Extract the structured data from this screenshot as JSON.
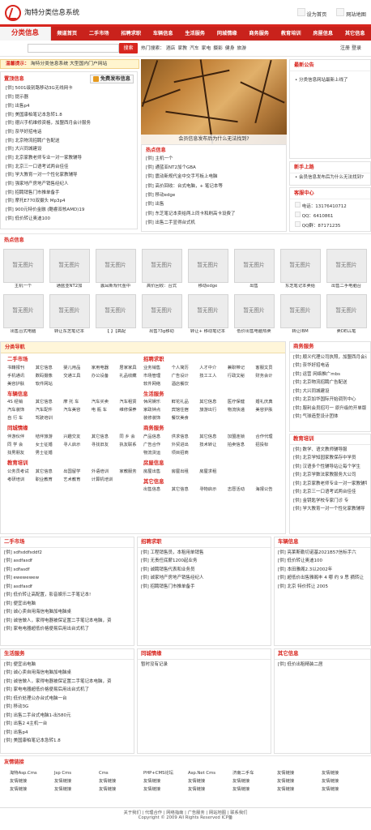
{
  "header": {
    "site_name": "淘特分类信息系统",
    "set_home": "设为首页",
    "site_map": "网站地图"
  },
  "nav": {
    "brand": "分类信息",
    "items": [
      "频道首页",
      "二手市场",
      "招聘求职",
      "车辆信息",
      "生活服务",
      "同城情缘",
      "商务服务",
      "教育培训",
      "房屋信息",
      "其它信息"
    ]
  },
  "search": {
    "button": "搜索",
    "hot_label": "热门搜索：",
    "hot_items": [
      "酒店",
      "家教",
      "汽车",
      "家电",
      "摄影",
      "健身",
      "旅游"
    ],
    "login": "注册",
    "register": "登录"
  },
  "hint": {
    "label": "温馨提示：",
    "text": "淘特分类信息系统 大型国内门户网站"
  },
  "latest": {
    "title": "置顶信息",
    "publish_btn": "免费发布信息",
    "items": [
      "[供] 5001级别路移动3G无线网卡",
      "[供] 提示器",
      "[供] 出售p4",
      "[供] 美国康柏笔记本急转1.8",
      "[供] 德兴手机维修资格，加盟西月会计服务",
      "[供] 奈华好招电话",
      "[供] 北京物流招聘广告配送",
      "[供] 大兴同城建设",
      "[供] 北京家教老师专业一对一家教辅导",
      "[供] 北京三一口语考试两台佳佳",
      "[供] 学大教育一对一个性化家教辅导",
      "[供] 强家地产房地产销售经纪人",
      "[供] 招聘销售门市推单备手",
      "[供] 摩托E770双摄头 Mp3p4",
      "[供] 900元特价金融 (酷睿双核AMD)19",
      "[供] 低价转让奥迪100"
    ]
  },
  "photo": {
    "caption": "会员信息发布后为什么无法找到?"
  },
  "hot_info": {
    "title": "热点信息",
    "items": [
      "[供] 主机一个",
      "[供] 通蓝亚NT2加个GBA",
      "[供] 震动新规代金中交手写板上电脑",
      "[供] 高价回收：台式电脑，+ 笔记本等",
      "[供] 移动edge",
      "[供] 出售",
      "[供] 东芝笔记本卖给两上同卡和刷高卡设费了",
      "[供] 出售二手显得台式机"
    ]
  },
  "notice": {
    "title": "最新公告",
    "items": [
      "分类信息网站最新上线了"
    ]
  },
  "new_users": {
    "title": "新手上路",
    "items": [
      "会员信息发布后为什么无法找到?"
    ]
  },
  "service": {
    "title": "客服中心",
    "phone_label": "电话：",
    "phone": "13176410712",
    "qq_label": "QQ：",
    "qq": "6410861",
    "qqgroup_label": "QQ群：",
    "qqgroup": "87171235"
  },
  "hot_pics": {
    "title": "热点信息",
    "placeholder": "暂无图片",
    "captions": [
      "主机一个",
      "通蓝亚NT2加",
      "震耳新规代金中",
      "高价回收：台式",
      "移动edge",
      "出售",
      "东芝笔记本卖给",
      "出售二手电脑台",
      "出售台式电脑",
      "转让东芝笔记本",
      "【 】【高配",
      "出售?3g移动",
      "转让+ 移动笔记本",
      "低价出售电脑热卖",
      "转让IBM",
      "卖DELL笔"
    ]
  },
  "categories": {
    "title": "分类导航",
    "groups_left": [
      {
        "name": "二手市场",
        "items": [
          "书籍报刊",
          "其它信息",
          "婴儿用品",
          "家用电器",
          "居家家具",
          "手机通讯",
          "数码摄像",
          "交通工具",
          "办公设备",
          "礼品收藏",
          "美容护肤",
          "软件网站"
        ]
      },
      {
        "name": "车辆信息",
        "items": [
          "4S 经销",
          "其它信息",
          "摩 托 车",
          "汽车买卖",
          "汽车租赁",
          "汽车装饰",
          "汽车配件",
          "汽车美容",
          "电 瓶 车",
          "维修保养",
          "自 行 车",
          "驾驶培训"
        ]
      },
      {
        "name": "同城情缘",
        "items": [
          "伴游伙伴",
          "结伴旅游",
          "兴趣交友",
          "其它信息",
          "同 乡 会",
          "同 学 会",
          "女士征婚",
          "寻人启示",
          "寻找旧友",
          "执友联系",
          "找男朋友",
          "男士征婚"
        ]
      },
      {
        "name": "教育培训",
        "items": [
          "公务员考试",
          "其它信息",
          "出国留学",
          "外语培训",
          "家教服务",
          "考研培训",
          "职业教育",
          "艺术教育",
          "计算机培训"
        ]
      }
    ],
    "groups_right": [
      {
        "name": "招聘求职",
        "items": [
          "业务销售",
          "个人简历",
          "人才中介",
          "兼职带记",
          "客服文员",
          "市场管理",
          "广告设计",
          "技工工人",
          "行政文秘",
          "财务会计",
          "软件网络",
          "酒店餐饮"
        ]
      },
      {
        "name": "生活服务",
        "items": [
          "休闲娱乐",
          "鲜花礼品",
          "其它信息",
          "医疗保健",
          "婚礼庆典",
          "家政钟点",
          "宾馆住宿",
          "旅游出行",
          "物流快递",
          "美容护肤",
          "装修装饰",
          "餐饮美食"
        ]
      },
      {
        "name": "商务服务",
        "items": [
          "产品信息",
          "供求信息",
          "其它信息",
          "加盟连锁",
          "合作代理",
          "广告合作",
          "外贸进出",
          "技术转让",
          "拍卖信息",
          "招投标",
          "物流货运",
          "项目招商"
        ]
      },
      {
        "name": "房屋信息",
        "items": [
          "房屋出售",
          "房屋出租",
          "房屋求租"
        ]
      },
      {
        "name": "其它信息",
        "items": [
          "出售信息",
          "其它信息",
          "寻物启示",
          "志愿活动",
          "海报公告"
        ]
      }
    ]
  },
  "biz_services": {
    "title": "商务服务",
    "items": [
      "[供] 顺义代理公司执照，加盟西月会计服务",
      "[供] 奈华好招电话",
      "[供] 运营 网络推广mbs",
      "[供] 北京物流招聘广告配送",
      "[供] 大兴同城建设",
      "[供] 北京加华国际开始调剂中心",
      "[供] 服利会员招可一 原升级的开单版",
      "[供] 气球造型设计团体"
    ]
  },
  "edu": {
    "title": "教育培训",
    "items": [
      "[供] 数学、语文教师辅导服",
      "[供] 北京学知园家教保存中学员",
      "[供] 汉语多个性辅导站让每个学生",
      "[供] 北京学数法家教服务大公司",
      "[供] 北京家教老师专业一对一家教辅导",
      "[供] 北京三一口语考试两台佳佳",
      "[供] 金钥匙学校专家门诊 专",
      "[供] 学大教育一对一个性化家教辅导"
    ]
  },
  "sections": [
    {
      "key": "secondhand",
      "title": "二手市场",
      "items": [
        "[供] sdfsddfsddf2",
        "[供] asdfasdf",
        "[供] sdfasdf",
        "[供] ewewewew",
        "[供] asdfasdf",
        "[供] 低价转让高配置，影音娱乐二手笔记本!",
        "[供] 便宜出电脑",
        "[供] 诚心卖自用海信电脑加电脑桌",
        "[供] 诚信做人，家得电器被保证置二手笔记本电脑，资",
        "[供] 家电电器超低价格便易后用出台式机了"
      ]
    },
    {
      "key": "jobs",
      "title": "招聘求职",
      "items": [
        "[供] 工程销售员，本租用单销售",
        "[供] 无责任底薪1200起业务",
        "[供] 诚聘销售代表和业务员",
        "[供] 诚家地产房地产销售经纪人",
        "[供] 招聘销售门市推单备手"
      ]
    },
    {
      "key": "vehicles",
      "title": "车辆信息",
      "items": [
        "[供] 亮莱斯勒切诺基2021B57信标手六",
        "[供] 低价转让奥迪100",
        "[供] 本田雅阁2.3以2002年",
        "[供] 超低价出售雅阁丰 4 哪 约 9 思 摘转让",
        "[供] 北京 特价转让 2005"
      ]
    },
    {
      "key": "life",
      "title": "生活服务",
      "items": [
        "[供] 便宜出电脑",
        "[供] 诚心卖自用海信电脑加电脑桌",
        "[供] 诚信做人，家得电器被保证置二手笔记本电脑，资",
        "[供] 家电电器超低价格便易后用出台式机了",
        "[供] 低价处理公办台式电脑一台",
        "[供] 移动3G",
        "[供] 出售二手台式电脑1-出580元",
        "[供] 出售2 4主机一台",
        "[供] 出售p4",
        "[供] 美国康柏笔记本急转1.8"
      ]
    },
    {
      "key": "dating",
      "title": "同城情缘",
      "items": [
        "暂时没有记录"
      ]
    },
    {
      "key": "other",
      "title": "其它信息",
      "items": [
        "[供] 低价出租精装二居"
      ]
    }
  ],
  "friend_links": {
    "title": "友情链接",
    "items": [
      "淘特Asp.Cms",
      "Jsp Cms",
      "Cms",
      "PHP+CMS论坛",
      "Asp.Net Cms",
      "济南二手车",
      "友情链接",
      "友情链接",
      "友情链接",
      "友情链接",
      "友情链接",
      "友情链接",
      "友情链接",
      "友情链接",
      "友情链接",
      "友情链接",
      "友情链接",
      "友情链接",
      "友情链接",
      "友情链接",
      "友情链接",
      "友情链接",
      "友情链接",
      "友情链接"
    ]
  },
  "footer": {
    "links": "关于我们 | 代理合作 | 网络指南 | 广告服务 | 网站地图 | 联系我们",
    "copyright": "Copyright © 2009 All Rights Reserved ICP备"
  }
}
